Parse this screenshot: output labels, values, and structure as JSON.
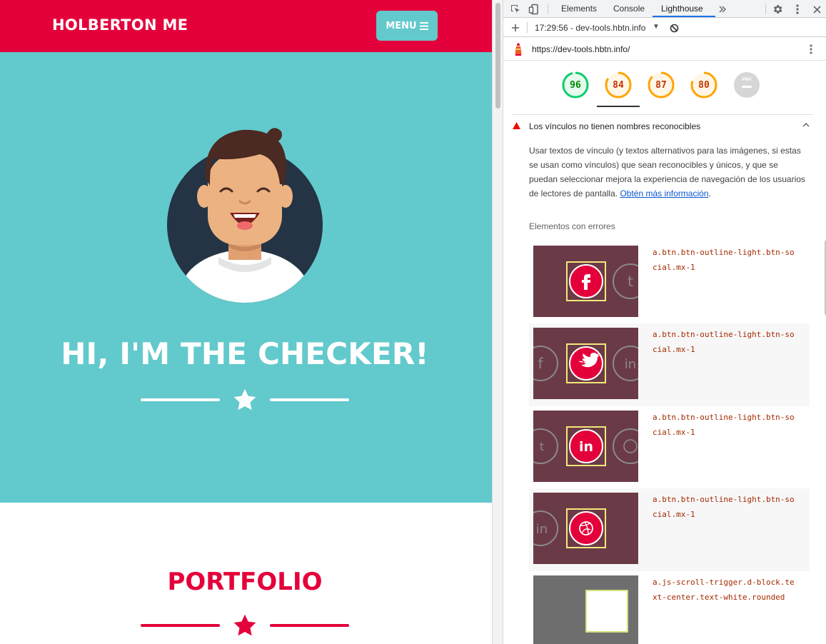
{
  "page": {
    "brand": "HOLBERTON ME",
    "menu_label": "MENU",
    "hero_title": "HI, I'M THE CHECKER!",
    "portfolio_title": "PORTFOLIO",
    "colors": {
      "primary": "#e4003a",
      "teal": "#62c9cc",
      "avatar_bg": "#243444"
    }
  },
  "devtools": {
    "tabs": [
      "Elements",
      "Console",
      "Lighthouse"
    ],
    "active_tab": "Lighthouse",
    "report_time": "17:29:56 - dev-tools.hbtn.info",
    "url": "https://dev-tools.hbtn.info/",
    "scores": [
      {
        "value": 96,
        "color": "#0cce6b"
      },
      {
        "value": 84,
        "color": "#ffa400"
      },
      {
        "value": 87,
        "color": "#ffa400"
      },
      {
        "value": 80,
        "color": "#ffa400"
      }
    ],
    "pwa_label": "PWA",
    "audit": {
      "title": "Los vínculos no tienen nombres reconocibles",
      "description": "Usar textos de vínculo (y textos alternativos para las imágenes, si estas se usan como vínculos) que sean reconocibles y únicos, y que se puedan seleccionar mejora la experiencia de navegación de los usuarios de lectores de pantalla.",
      "learn_more": "Obtén más información",
      "failing_label": "Elementos con errores",
      "elements": [
        {
          "selector": "a.btn.btn-outline-light.btn-social.mx-1",
          "icon": "facebook-icon"
        },
        {
          "selector": "a.btn.btn-outline-light.btn-social.mx-1",
          "icon": "twitter-icon"
        },
        {
          "selector": "a.btn.btn-outline-light.btn-social.mx-1",
          "icon": "linkedin-icon"
        },
        {
          "selector": "a.btn.btn-outline-light.btn-social.mx-1",
          "icon": "dribbble-icon"
        },
        {
          "selector": "a.js-scroll-trigger.d-block.text-center.text-white.rounded",
          "icon": "blank-thumbnail"
        }
      ]
    }
  }
}
